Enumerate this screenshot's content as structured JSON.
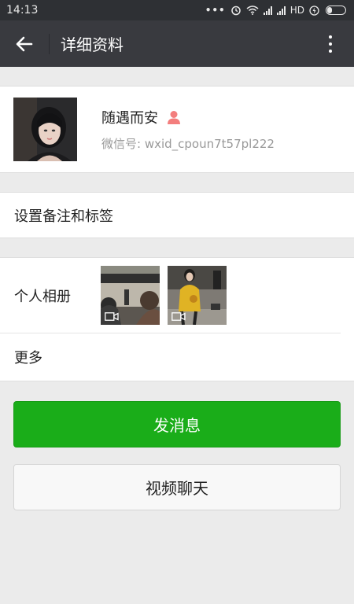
{
  "status_bar": {
    "time": "14:13",
    "dots": "•••",
    "network": "HD"
  },
  "header": {
    "title": "详细资料",
    "back_icon": "arrow-left-icon",
    "more_icon": "more-vertical-icon"
  },
  "profile": {
    "nickname": "随遇而安",
    "wxid_label": "微信号: ",
    "wxid": "wxid_cpoun7t57pl222",
    "gender_icon": "female-person-icon",
    "gender_color": "#f37e7d"
  },
  "remark": {
    "label": "设置备注和标签"
  },
  "album": {
    "label": "个人相册",
    "thumbs": [
      "video-thumbnail-1",
      "video-thumbnail-2"
    ]
  },
  "more": {
    "label": "更多"
  },
  "actions": {
    "send_label": "发消息",
    "video_label": "视频聊天"
  },
  "colors": {
    "accent_green": "#1aad19",
    "header_bg": "#393a3f",
    "page_bg": "#ebebeb"
  }
}
